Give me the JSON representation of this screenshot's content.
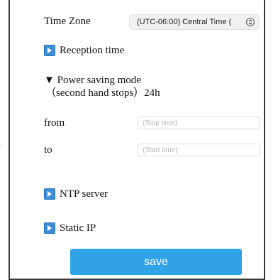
{
  "time_zone": {
    "label": "Time Zone",
    "selected": "(UTC-06:00) Central Time ("
  },
  "reception_time": {
    "label": "Reception time"
  },
  "power_saving": {
    "label": "▼ Power saving mode",
    "detail": "（second hand stops）24h",
    "from_label": "from",
    "from_placeholder": "(Stop time)",
    "to_label": "to",
    "to_placeholder": "(Start time)"
  },
  "ntp_server": {
    "label": "NTP server"
  },
  "static_ip": {
    "label": "Static IP"
  },
  "save": {
    "label": "save"
  },
  "colors": {
    "accent": "#30a3e6",
    "icon_blue": "#3d8ed6"
  },
  "icons": {
    "expand": "play-icon",
    "select_stepper": "chevron-up-down-icon"
  }
}
